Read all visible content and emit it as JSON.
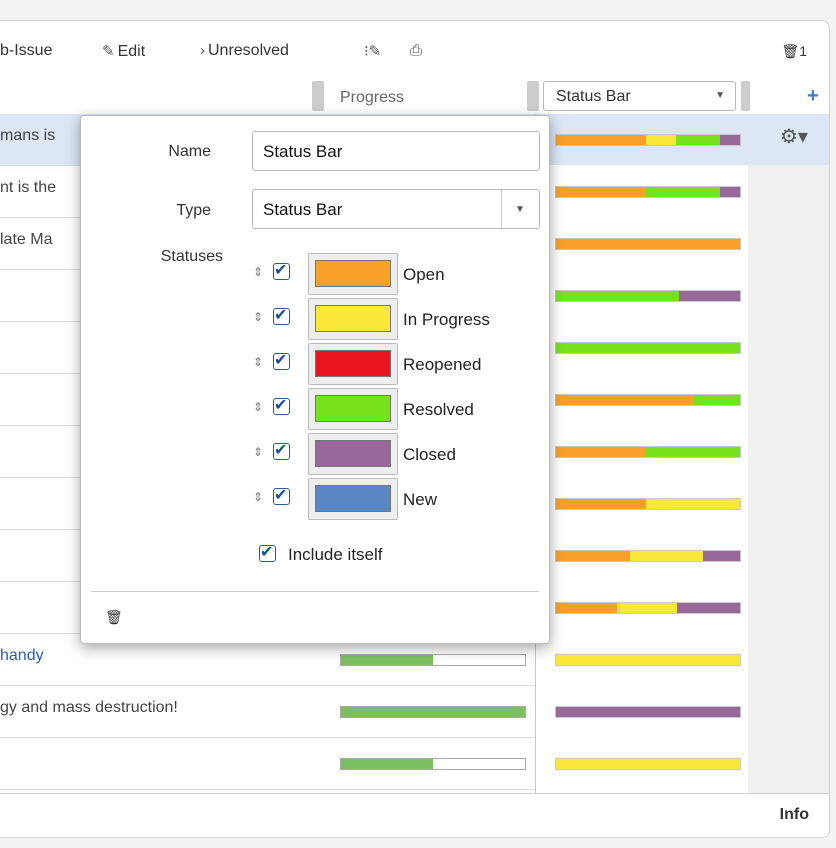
{
  "toolbar": {
    "subissue": "b-Issue",
    "edit": "Edit",
    "unresolved": "Unresolved",
    "delete_count": "1"
  },
  "header": {
    "progress": "Progress",
    "status_bar_select": "Status Bar",
    "add": "+"
  },
  "rows": [
    {
      "text": "mans is",
      "selected": true
    },
    {
      "text": "nt is the"
    },
    {
      "text": "late Ma"
    },
    {
      "text": ""
    },
    {
      "text": ""
    },
    {
      "text": ""
    },
    {
      "text": ""
    },
    {
      "text": ""
    },
    {
      "text": ""
    },
    {
      "text": ""
    },
    {
      "text": "handy",
      "link": true
    },
    {
      "text": "gy and mass destruction!"
    },
    {
      "text": ""
    }
  ],
  "colors": {
    "open": "#f7a02a",
    "in_progress": "#f9e83a",
    "reopened": "#e8151e",
    "resolved": "#76e21e",
    "closed": "#9a679b",
    "new": "#5a86c4"
  },
  "status_bars": [
    [
      {
        "c": "open",
        "v": 0.49
      },
      {
        "c": "in_progress",
        "v": 0.16
      },
      {
        "c": "resolved",
        "v": 0.24
      },
      {
        "c": "closed",
        "v": 0.11
      }
    ],
    [
      {
        "c": "open",
        "v": 0.49
      },
      {
        "c": "resolved",
        "v": 0.4
      },
      {
        "c": "closed",
        "v": 0.11
      }
    ],
    [
      {
        "c": "open",
        "v": 1.0
      }
    ],
    [
      {
        "c": "resolved",
        "v": 0.67
      },
      {
        "c": "closed",
        "v": 0.33
      }
    ],
    [
      {
        "c": "resolved",
        "v": 1.0
      }
    ],
    [
      {
        "c": "open",
        "v": 0.75
      },
      {
        "c": "resolved",
        "v": 0.25
      }
    ],
    [
      {
        "c": "open",
        "v": 0.49
      },
      {
        "c": "resolved",
        "v": 0.51
      }
    ],
    [
      {
        "c": "open",
        "v": 0.49
      },
      {
        "c": "in_progress",
        "v": 0.51
      }
    ],
    [
      {
        "c": "open",
        "v": 0.4
      },
      {
        "c": "in_progress",
        "v": 0.4
      },
      {
        "c": "closed",
        "v": 0.2
      }
    ],
    [
      {
        "c": "open",
        "v": 0.33
      },
      {
        "c": "in_progress",
        "v": 0.33
      },
      {
        "c": "closed",
        "v": 0.34
      }
    ],
    [
      {
        "c": "in_progress",
        "v": 1.0
      }
    ],
    [
      {
        "c": "closed",
        "v": 1.0
      }
    ],
    [
      {
        "c": "in_progress",
        "v": 1.0
      }
    ]
  ],
  "progress_bars": [
    0.5,
    1.0,
    0.5
  ],
  "popup": {
    "name_label": "Name",
    "name_value": "Status Bar",
    "type_label": "Type",
    "type_value": "Status Bar",
    "statuses_label": "Statuses",
    "statuses": [
      {
        "name": "Open",
        "color": "open",
        "checked": true
      },
      {
        "name": "In Progress",
        "color": "in_progress",
        "checked": true
      },
      {
        "name": "Reopened",
        "color": "reopened",
        "checked": true
      },
      {
        "name": "Resolved",
        "color": "resolved",
        "checked": true
      },
      {
        "name": "Closed",
        "color": "closed",
        "checked": true
      },
      {
        "name": "New",
        "color": "new",
        "checked": true
      }
    ],
    "include_itself": "Include itself"
  },
  "footer": {
    "info": "Info"
  }
}
